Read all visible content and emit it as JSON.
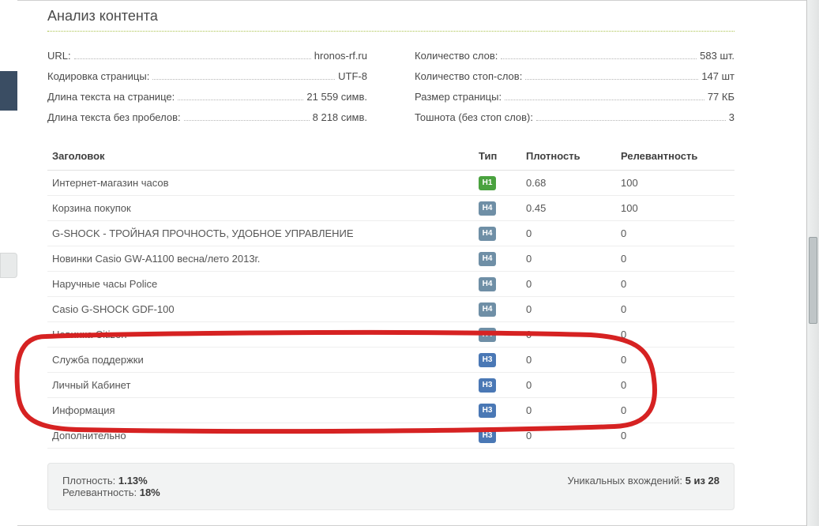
{
  "page_title": "Анализ контента",
  "stats_left": [
    {
      "label": "URL:",
      "value": "hronos-rf.ru"
    },
    {
      "label": "Кодировка страницы:",
      "value": "UTF-8"
    },
    {
      "label": "Длина текста на странице:",
      "value": "21 559 симв."
    },
    {
      "label": "Длина текста без пробелов:",
      "value": "8 218 симв."
    }
  ],
  "stats_right": [
    {
      "label": "Количество слов:",
      "value": "583 шт."
    },
    {
      "label": "Количество стоп-слов:",
      "value": "147 шт"
    },
    {
      "label": "Размер страницы:",
      "value": "77 КБ"
    },
    {
      "label": "Тошнота (без стоп слов):",
      "value": "3"
    }
  ],
  "table": {
    "columns": {
      "title": "Заголовок",
      "type": "Тип",
      "density": "Плотность",
      "relevance": "Релевантность"
    },
    "rows": [
      {
        "title": "Интернет-магазин часов",
        "type": "H1",
        "type_class": "h1",
        "density": "0.68",
        "relevance": "100"
      },
      {
        "title": "Корзина покупок",
        "type": "H4",
        "type_class": "h4",
        "density": "0.45",
        "relevance": "100"
      },
      {
        "title": "G-SHOCK - ТРОЙНАЯ ПРОЧНОСТЬ, УДОБНОЕ УПРАВЛЕНИЕ",
        "type": "H4",
        "type_class": "h4",
        "density": "0",
        "relevance": "0"
      },
      {
        "title": "Новинки Casio GW-A1100 весна/лето 2013г.",
        "type": "H4",
        "type_class": "h4",
        "density": "0",
        "relevance": "0"
      },
      {
        "title": "Наручные часы Police",
        "type": "H4",
        "type_class": "h4",
        "density": "0",
        "relevance": "0"
      },
      {
        "title": "Casio G-SHOCK GDF-100",
        "type": "H4",
        "type_class": "h4",
        "density": "0",
        "relevance": "0"
      },
      {
        "title": "Новинка Citizen",
        "type": "H4",
        "type_class": "h4",
        "density": "0",
        "relevance": "0"
      },
      {
        "title": "Служба поддержки",
        "type": "H3",
        "type_class": "h3",
        "density": "0",
        "relevance": "0"
      },
      {
        "title": "Личный Кабинет",
        "type": "H3",
        "type_class": "h3",
        "density": "0",
        "relevance": "0"
      },
      {
        "title": "Информация",
        "type": "H3",
        "type_class": "h3",
        "density": "0",
        "relevance": "0"
      },
      {
        "title": "Дополнительно",
        "type": "H3",
        "type_class": "h3",
        "density": "0",
        "relevance": "0"
      }
    ]
  },
  "summary": {
    "density_label": "Плотность:",
    "density_value": "1.13%",
    "relevance_label": "Релевантность:",
    "relevance_value": "18%",
    "unique_label": "Уникальных вхождений:",
    "unique_value": "5 из 28"
  }
}
